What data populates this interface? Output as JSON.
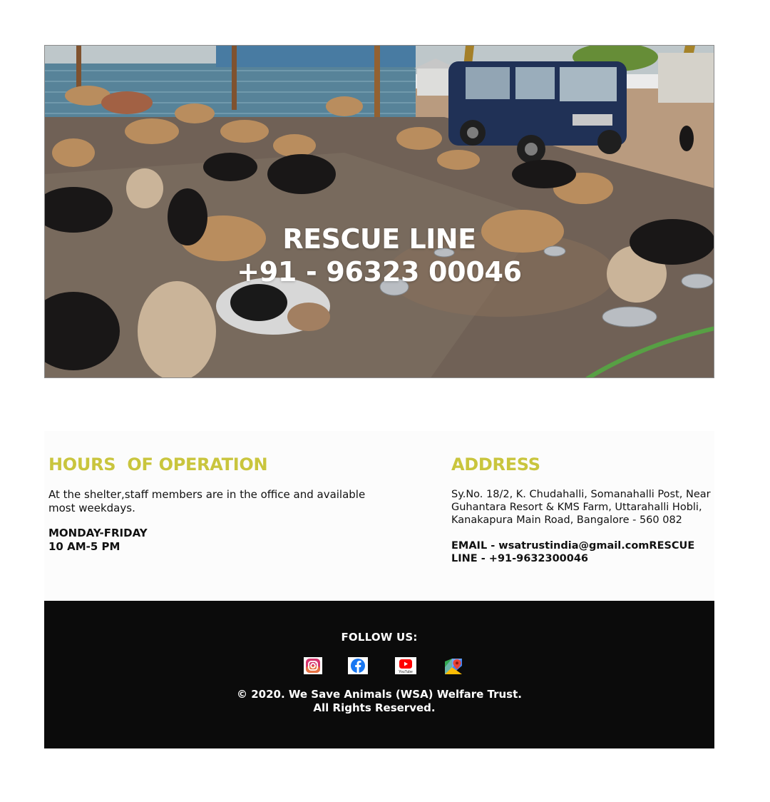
{
  "hero": {
    "title": "RESCUE LINE",
    "phone": "+91 - 96323 00046"
  },
  "hours": {
    "heading": "HOURS  OF OPERATION",
    "description": "At the shelter,staff members are in the office and available most weekdays.",
    "days": "MONDAY-FRIDAY",
    "time": "10 AM-5 PM"
  },
  "address": {
    "heading": "ADDRESS",
    "text": "Sy.No. 18/2, K. Chudahalli, Somanahalli Post, Near Guhantara Resort & KMS Farm, Uttarahalli Hobli, Kanakapura Main Road, Bangalore - 560 082",
    "contact": "EMAIL - wsatrustindia@gmail.comRESCUE LINE - +91-9632300046"
  },
  "footer": {
    "follow_label": "FOLLOW US:",
    "social": [
      {
        "name": "instagram-icon"
      },
      {
        "name": "facebook-icon"
      },
      {
        "name": "youtube-icon",
        "label": "YouTube"
      },
      {
        "name": "google-maps-icon"
      }
    ],
    "copyright_line1": "© 2020. We Save Animals (WSA) Welfare Trust.",
    "copyright_line2": "All Rights Reserved."
  },
  "colors": {
    "accent": "#c9c53d",
    "footer_bg": "#0b0b0b",
    "info_bg": "#fcfcfc"
  }
}
